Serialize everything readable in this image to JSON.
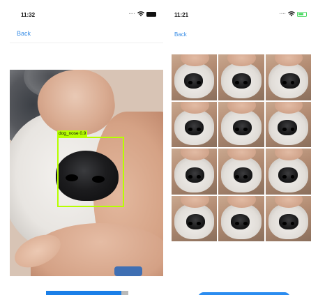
{
  "left_screen": {
    "status": {
      "time": "11:32"
    },
    "nav": {
      "back_label": "Back"
    },
    "detection": {
      "label": "dog_nose 0.9",
      "box_color": "#b6ff00"
    }
  },
  "right_screen": {
    "status": {
      "time": "11:21"
    },
    "nav": {
      "back_label": "Back"
    },
    "grid": {
      "rows": 4,
      "columns": 3,
      "tile_count": 12
    }
  },
  "colors": {
    "link_blue": "#3a8ee6",
    "button_blue": "#1a7fe8",
    "battery_green": "#4cd964"
  },
  "icons": [
    "wifi-icon",
    "battery-icon"
  ]
}
